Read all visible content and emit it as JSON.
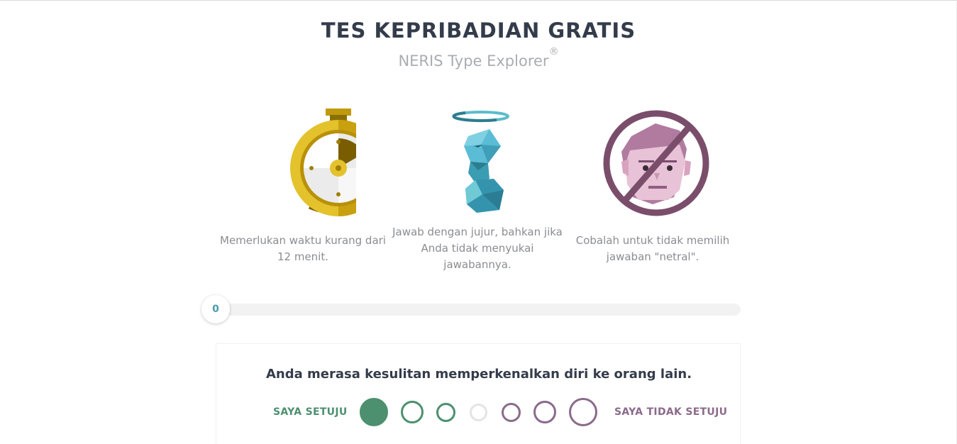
{
  "header": {
    "title": "TES KEPRIBADIAN GRATIS",
    "subtitle": "NERIS Type Explorer",
    "subtitle_mark": "®"
  },
  "features": [
    {
      "icon": "stopwatch-icon",
      "text": "Memerlukan waktu kurang dari 12 menit."
    },
    {
      "icon": "angel-figure-icon",
      "text": "Jawab dengan jujur, bahkan jika Anda tidak menyukai jawabannya."
    },
    {
      "icon": "no-neutral-face-icon",
      "text": "Cobalah untuk tidak memilih jawaban \"netral\"."
    }
  ],
  "progress": {
    "value_label": "0",
    "fraction": 0
  },
  "question": {
    "text": "Anda merasa kesulitan memperkenalkan diri ke orang lain.",
    "agree_label": "SAYA SETUJU",
    "disagree_label": "SAYA TIDAK SETUJU",
    "selected_option_index": 0
  },
  "colors": {
    "agree": "#4c906f",
    "disagree": "#8a6b8a",
    "neutral": "#e4e4e4",
    "progress_text": "#4a9bb0"
  }
}
